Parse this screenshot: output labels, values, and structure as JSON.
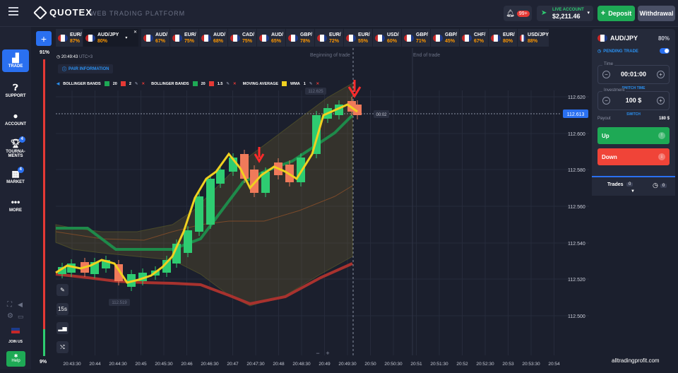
{
  "header": {
    "logo": "QUOTEX",
    "platform": "WEB TRADING PLATFORM",
    "notif_badge": "99+",
    "account_label": "LIVE ACCOUNT",
    "balance": "$2,211.46",
    "deposit": "Deposit",
    "withdrawal": "Withdrawal"
  },
  "sidebar": {
    "items": [
      {
        "label": "TRADE",
        "icon": "chart-icon"
      },
      {
        "label": "SUPPORT",
        "icon": "help-icon"
      },
      {
        "label": "ACCOUNT",
        "icon": "user-icon"
      },
      {
        "label": "TOURNA-MENTS",
        "icon": "trophy-icon",
        "badge": "4"
      },
      {
        "label": "MARKET",
        "icon": "market-icon",
        "badge": "4"
      },
      {
        "label": "MORE",
        "icon": "dots-icon"
      }
    ],
    "join_us": "JOIN US",
    "help": "Help"
  },
  "tabs": [
    {
      "name": "EUR/",
      "pct": "87%"
    },
    {
      "name": "AUD/JPY",
      "pct": "80%"
    },
    {
      "name": "AUD/",
      "pct": "67%"
    },
    {
      "name": "EUR/",
      "pct": "75%"
    },
    {
      "name": "AUD/",
      "pct": "68%"
    },
    {
      "name": "CAD/",
      "pct": "75%"
    },
    {
      "name": "AUD/",
      "pct": "65%"
    },
    {
      "name": "GBP/",
      "pct": "78%"
    },
    {
      "name": "EUR/",
      "pct": "72%"
    },
    {
      "name": "EUR/",
      "pct": "55%"
    },
    {
      "name": "USD/",
      "pct": "60%"
    },
    {
      "name": "GBP/",
      "pct": "71%"
    },
    {
      "name": "GBP/",
      "pct": "45%"
    },
    {
      "name": "CHF/",
      "pct": "67%"
    },
    {
      "name": "EUR/",
      "pct": "80%"
    },
    {
      "name": "USD/JPY",
      "pct": "88%"
    }
  ],
  "chart": {
    "pct_top": "91%",
    "pct_bottom": "9%",
    "progress": 0.09,
    "time": "20:49:43",
    "tz": "UTC+3",
    "pair_info": "PAIR INFORMATION",
    "indicators": [
      {
        "name": "BOLLINGER BANDS",
        "p1": "20",
        "p2": "2"
      },
      {
        "name": "BOLLINGER BANDS",
        "p1": "20",
        "p2": "1.5"
      },
      {
        "name": "MOVING AVERAGE",
        "p1": "WMA",
        "p2": "1"
      }
    ],
    "begin_label": "Beginning of trade",
    "end_label": "End of trade",
    "high_label": "112.625",
    "low_label": "112.519",
    "countdown": "00:02",
    "current_price": "112.613",
    "y_ticks": [
      "112.620",
      "112.600",
      "112.580",
      "112.560",
      "112.540",
      "112.520",
      "112.500"
    ],
    "x_ticks": [
      "20:43:30",
      "20:44",
      "20:44:30",
      "20:45",
      "20:45:30",
      "20:46",
      "20:46:30",
      "20:47",
      "20:47:30",
      "20:48",
      "20:48:30",
      "20:49",
      "20:49:30",
      "20:50",
      "20:50:30",
      "20:51",
      "20:51:30",
      "20:52",
      "20:52:30",
      "20:53",
      "20:53:30",
      "20:54"
    ],
    "timeframe": "15s"
  },
  "panel": {
    "pair": "AUD/JPY",
    "pct": "80%",
    "pending": "PENDING TRADE",
    "time_label": "Time",
    "time_val": "00:01:00",
    "time_sub": "SWITCH TIME",
    "inv_label": "Investment",
    "inv_val": "100 $",
    "inv_sub": "SWITCH",
    "payout_label": "Payout",
    "payout_val": "180 $",
    "up": "Up",
    "down": "Down",
    "trades": "Trades",
    "trades_count": "0",
    "clock_count": "0"
  },
  "watermark": "alltradingprofit.com",
  "colors": {
    "accent": "#2a70f0",
    "up": "#1ea955",
    "down": "#e53935",
    "wma": "#f0d020"
  }
}
